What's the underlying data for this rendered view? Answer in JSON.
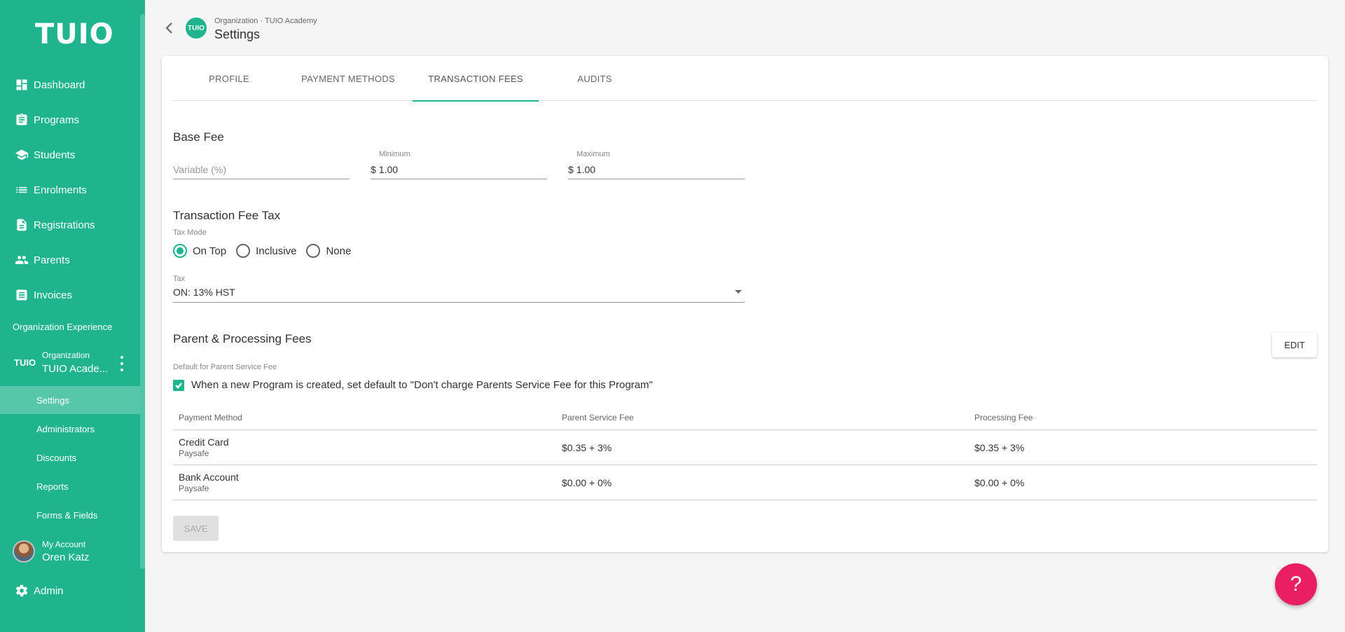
{
  "sidebar": {
    "logo": "TUIO",
    "nav": [
      {
        "label": "Dashboard",
        "icon": "dashboard-icon"
      },
      {
        "label": "Programs",
        "icon": "clipboard-icon"
      },
      {
        "label": "Students",
        "icon": "school-icon"
      },
      {
        "label": "Enrolments",
        "icon": "list-icon"
      },
      {
        "label": "Registrations",
        "icon": "document-icon"
      },
      {
        "label": "Parents",
        "icon": "people-icon"
      },
      {
        "label": "Invoices",
        "icon": "invoice-icon"
      }
    ],
    "section_label": "Organization Experience",
    "org": {
      "logo": "TUIO",
      "small": "Organization",
      "name": "TUIO Acade..."
    },
    "sub_items": [
      "Settings",
      "Administrators",
      "Discounts",
      "Reports",
      "Forms & Fields"
    ],
    "account": {
      "small": "My Account",
      "name": "Oren Katz"
    },
    "admin_label": "Admin"
  },
  "header": {
    "logo": "TUIO",
    "breadcrumb": "Organization · TUIO Academy",
    "title": "Settings"
  },
  "tabs": [
    "PROFILE",
    "PAYMENT METHODS",
    "TRANSACTION FEES",
    "AUDITS"
  ],
  "active_tab": "TRANSACTION FEES",
  "base_fee": {
    "title": "Base Fee",
    "variable_placeholder": "Variable (%)",
    "minimum_label": "Minimum",
    "minimum_value": "1.00",
    "maximum_label": "Maximum",
    "maximum_value": "1.00",
    "currency": "$"
  },
  "tax": {
    "title": "Transaction Fee Tax",
    "mode_label": "Tax Mode",
    "modes": [
      "On Top",
      "Inclusive",
      "None"
    ],
    "selected_mode": "On Top",
    "tax_label": "Tax",
    "tax_value": "ON: 13% HST"
  },
  "parent_fees": {
    "title": "Parent & Processing Fees",
    "edit_label": "EDIT",
    "default_label": "Default for Parent Service Fee",
    "checkbox_text": "When a new Program is created, set default to \"Don't charge Parents Service Fee for this Program\"",
    "checkbox_checked": true,
    "columns": [
      "Payment Method",
      "Parent Service Fee",
      "Processing Fee"
    ],
    "rows": [
      {
        "method": "Credit Card",
        "provider": "Paysafe",
        "parent_fee": "$0.35 + 3%",
        "processing_fee": "$0.35 + 3%"
      },
      {
        "method": "Bank Account",
        "provider": "Paysafe",
        "parent_fee": "$0.00 + 0%",
        "processing_fee": "$0.00 + 0%"
      }
    ]
  },
  "save_label": "SAVE",
  "help_label": "?",
  "colors": {
    "brand": "#1fb48e",
    "fab": "#e91e63"
  }
}
